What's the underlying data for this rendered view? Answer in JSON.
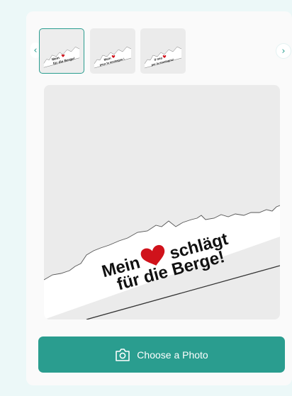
{
  "thumbnails": [
    {
      "line1": "Mein",
      "line2": "für die Berge!",
      "selected": true
    },
    {
      "line1": "Mein",
      "line2": "pour la montagne !",
      "selected": false
    },
    {
      "line1": "Il mio",
      "line2": "per la montagna!",
      "selected": false
    }
  ],
  "preview": {
    "word_before_heart": "Mein",
    "word_after_heart": "schlägt",
    "line2": "für die Berge!",
    "heart_color": "#d0121b"
  },
  "carousel": {
    "prev_icon": "chevron-left-icon",
    "next_icon": "chevron-right-icon"
  },
  "choose_button": {
    "label": "Choose a Photo",
    "icon": "camera-icon"
  },
  "colors": {
    "accent": "#2a9d8f",
    "page_background": "#ecf8f8"
  }
}
